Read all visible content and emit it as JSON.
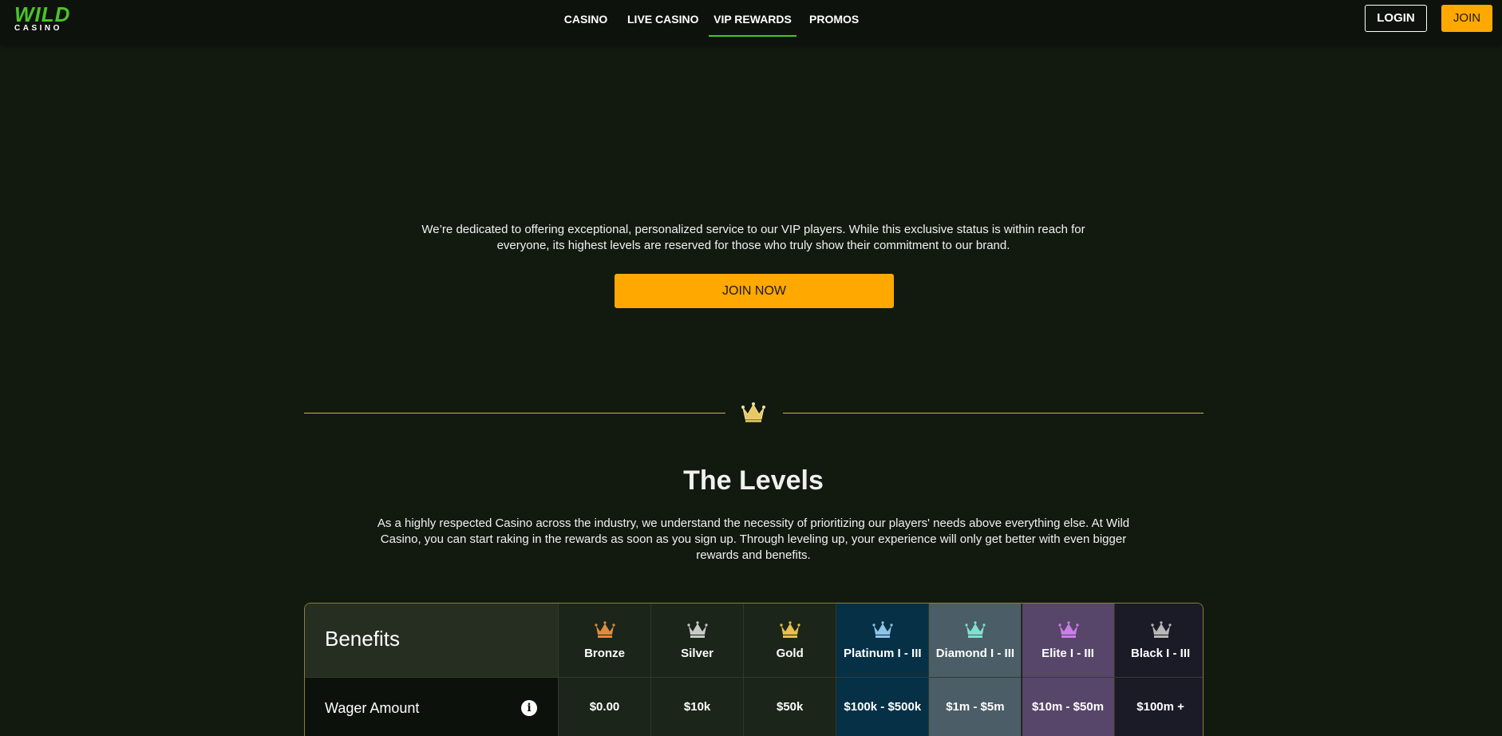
{
  "header": {
    "logo_main": "WILD",
    "logo_sub": "CASINO",
    "nav": [
      "CASINO",
      "LIVE CASINO",
      "VIP REWARDS",
      "PROMOS"
    ],
    "active_nav": "VIP REWARDS",
    "login_label": "LOGIN",
    "join_label": "JOIN"
  },
  "hero": {
    "text": "We’re dedicated to offering exceptional, personalized service to our VIP players. While this exclusive status is within reach for everyone, its highest levels are reserved for those who truly show their commitment to our brand.",
    "cta_label": "JOIN NOW"
  },
  "levels": {
    "title": "The Levels",
    "text": "As a highly respected Casino across the industry, we understand the necessity of prioritizing our players' needs above everything else. At Wild Casino, you can start raking in the rewards as soon as you sign up. Through leveling up, your experience will only get better with even bigger rewards and benefits."
  },
  "table": {
    "benefits_label": "Benefits",
    "wager_label": "Wager Amount",
    "info_icon": "info-icon",
    "tiers": [
      {
        "name": "Bronze",
        "wager": "$0.00",
        "crown_color": "#e08a3c",
        "bg": "#1c2519"
      },
      {
        "name": "Silver",
        "wager": "$10k",
        "crown_color": "#c9c9c9",
        "bg": "#1c2519"
      },
      {
        "name": "Gold",
        "wager": "$50k",
        "crown_color": "#e8c14a",
        "bg": "#1c2519"
      },
      {
        "name": "Platinum I - III",
        "wager": "$100k - $500k",
        "crown_color": "#8fc3e8",
        "bg": "#063046"
      },
      {
        "name": "Diamond I - III",
        "wager": "$1m - $5m",
        "crown_color": "#7fe0d0",
        "bg": "#4b5d66"
      },
      {
        "name": "Elite I - III",
        "wager": "$10m - $50m",
        "crown_color": "#c97ee8",
        "bg": "#574669"
      },
      {
        "name": "Black I - III",
        "wager": "$100m +",
        "crown_color": "#b8b8b8",
        "bg": "#1b1a27"
      }
    ]
  },
  "colors": {
    "background": "#121a10",
    "accent_green": "#4cc32b",
    "accent_orange": "#ffa800",
    "divider_gold": "#c9b35a"
  }
}
